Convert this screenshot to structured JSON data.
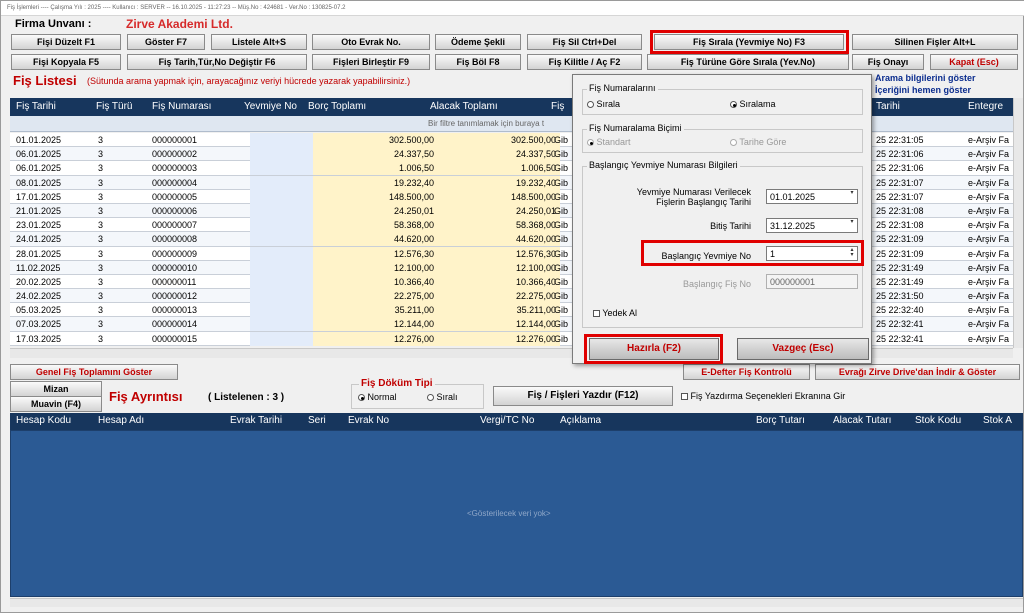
{
  "window": {
    "title": "Fiş İşlemleri  ----  Çalışma Yılı : 2025  ----  Kullanıcı : SERVER -- 16.10.2025 - 11:27:23 -- Müş.No : 424681 - Ver.No : 130825-07.2"
  },
  "company": {
    "label": "Firma  Unvanı :",
    "name": "Zirve Akademi Ltd."
  },
  "toolbar": {
    "row1": [
      "Fişi Düzelt F1",
      "Göster F7",
      "Listele Alt+S",
      "Oto Evrak No.",
      "Ödeme Şekli",
      "Fiş Sil Ctrl+Del",
      "Fiş Sırala (Yevmiye No) F3",
      "Silinen Fişler Alt+L"
    ],
    "row2": [
      "Fişi Kopyala F5",
      "Fiş Tarih,Tür,No Değiştir F6",
      "Fişleri Birleştir F9",
      "Fiş Böl F8",
      "Fiş Kilitle / Aç F2",
      "Fiş Türüne Göre Sırala (Yev.No)",
      "Fiş Onayı",
      "Kapat (Esc)"
    ]
  },
  "list": {
    "title": "Fiş Listesi",
    "hint": "(Sütunda arama yapmak için, arayacağınız veriyi hücrede yazarak yapabilirsiniz.)",
    "right_links": [
      "Arama bilgilerini göster",
      "İçeriğini hemen göster"
    ],
    "columns": [
      "Fiş Tarihi",
      "Fiş Türü",
      "Fiş Numarası",
      "Yevmiye No",
      "Borç Toplamı",
      "Alacak Toplamı",
      "Fiş",
      "Tarihi",
      "Entegre"
    ],
    "filter_hint": "Bir filtre tanımlamak için buraya t",
    "rows": [
      {
        "date": "01.01.2025",
        "type": "3",
        "no": "000000001",
        "borc": "302.500,00",
        "alacak": "302.500,00",
        "fis": "Gib",
        "time": "25 22:31:05",
        "entegre": "e-Arşiv Fa"
      },
      {
        "date": "06.01.2025",
        "type": "3",
        "no": "000000002",
        "borc": "24.337,50",
        "alacak": "24.337,50",
        "fis": "Gib",
        "time": "25 22:31:06",
        "entegre": "e-Arşiv Fa"
      },
      {
        "date": "06.01.2025",
        "type": "3",
        "no": "000000003",
        "borc": "1.006,50",
        "alacak": "1.006,50",
        "fis": "Gib",
        "time": "25 22:31:06",
        "entegre": "e-Arşiv Fa"
      },
      {
        "date": "08.01.2025",
        "type": "3",
        "no": "000000004",
        "borc": "19.232,40",
        "alacak": "19.232,40",
        "fis": "Gib",
        "time": "25 22:31:07",
        "entegre": "e-Arşiv Fa"
      },
      {
        "date": "17.01.2025",
        "type": "3",
        "no": "000000005",
        "borc": "148.500,00",
        "alacak": "148.500,00",
        "fis": "Gib",
        "time": "25 22:31:07",
        "entegre": "e-Arşiv Fa"
      },
      {
        "date": "21.01.2025",
        "type": "3",
        "no": "000000006",
        "borc": "24.250,01",
        "alacak": "24.250,01",
        "fis": "Gib",
        "time": "25 22:31:08",
        "entegre": "e-Arşiv Fa"
      },
      {
        "date": "23.01.2025",
        "type": "3",
        "no": "000000007",
        "borc": "58.368,00",
        "alacak": "58.368,00",
        "fis": "Gib",
        "time": "25 22:31:08",
        "entegre": "e-Arşiv Fa"
      },
      {
        "date": "24.01.2025",
        "type": "3",
        "no": "000000008",
        "borc": "44.620,00",
        "alacak": "44.620,00",
        "fis": "Gib",
        "time": "25 22:31:09",
        "entegre": "e-Arşiv Fa"
      },
      {
        "date": "28.01.2025",
        "type": "3",
        "no": "000000009",
        "borc": "12.576,30",
        "alacak": "12.576,30",
        "fis": "Gib",
        "time": "25 22:31:09",
        "entegre": "e-Arşiv Fa"
      },
      {
        "date": "11.02.2025",
        "type": "3",
        "no": "000000010",
        "borc": "12.100,00",
        "alacak": "12.100,00",
        "fis": "Gib",
        "time": "25 22:31:49",
        "entegre": "e-Arşiv Fa"
      },
      {
        "date": "20.02.2025",
        "type": "3",
        "no": "000000011",
        "borc": "10.366,40",
        "alacak": "10.366,40",
        "fis": "Gib",
        "time": "25 22:31:49",
        "entegre": "e-Arşiv Fa"
      },
      {
        "date": "24.02.2025",
        "type": "3",
        "no": "000000012",
        "borc": "22.275,00",
        "alacak": "22.275,00",
        "fis": "Gib",
        "time": "25 22:31:50",
        "entegre": "e-Arşiv Fa"
      },
      {
        "date": "05.03.2025",
        "type": "3",
        "no": "000000013",
        "borc": "35.211,00",
        "alacak": "35.211,00",
        "fis": "Gib",
        "time": "25 22:32:40",
        "entegre": "e-Arşiv Fa"
      },
      {
        "date": "07.03.2025",
        "type": "3",
        "no": "000000014",
        "borc": "12.144,00",
        "alacak": "12.144,00",
        "fis": "Gib",
        "time": "25 22:32:41",
        "entegre": "e-Arşiv Fa"
      },
      {
        "date": "17.03.2025",
        "type": "3",
        "no": "000000015",
        "borc": "12.276,00",
        "alacak": "12.276,00",
        "fis": "Gib",
        "time": "25 22:32:41",
        "entegre": "e-Arşiv Fa"
      }
    ]
  },
  "bottom_bar": {
    "genel": "Genel Fiş Toplamını Göster",
    "mizan": "Mizan",
    "muavin": "Muavin (F4)",
    "edefter": "E-Defter Fiş Kontrolü",
    "drive": "Evrağı Zirve Drive'dan İndir & Göster"
  },
  "detail": {
    "title": "Fiş Ayrıntısı",
    "count": "( Listelenen : 3 )",
    "dokum_label": "Fiş Döküm Tipi",
    "dokum_options": [
      "Normal",
      "Sıralı"
    ],
    "print_button": "Fiş / Fişleri Yazdır (F12)",
    "print_option": "Fiş Yazdırma Seçenekleri Ekranına Gir",
    "columns": [
      "Hesap Kodu",
      "Hesap Adı",
      "Evrak Tarihi",
      "Seri",
      "Evrak No",
      "Vergi/TC No",
      "Açıklama",
      "Borç Tutarı",
      "Alacak Tutarı",
      "Stok Kodu",
      "Stok A"
    ],
    "empty": "<Gösterilecek veri yok>"
  },
  "dialog": {
    "group1": "Fiş Numaralarını",
    "sirala": "Sırala",
    "siralama": "Sıralama",
    "group2": "Fiş Numaralama Biçimi",
    "standart": "Standart",
    "tarihe_gore": "Tarihe Göre",
    "group3": "Başlangıç Yevmiye Numarası Bilgileri",
    "start_date_label_1": "Yevmiye Numarası Verilecek",
    "start_date_label_2": "Fişlerin Başlangıç Tarihi",
    "start_date": "01.01.2025",
    "end_date_label": "Bitiş Tarihi",
    "end_date": "31.12.2025",
    "yevmiye_label": "Başlangıç Yevmiye No",
    "yevmiye_value": "1",
    "fis_label": "Başlangıç Fiş No",
    "fis_value": "000000001",
    "yedek": "Yedek Al",
    "ok": "Hazırla (F2)",
    "cancel": "Vazgeç (Esc)"
  },
  "colors": {
    "header_blue": "#17365d",
    "detail_blue": "#2b5a94",
    "highlight_red": "#e00000",
    "title_red": "#c00000"
  }
}
